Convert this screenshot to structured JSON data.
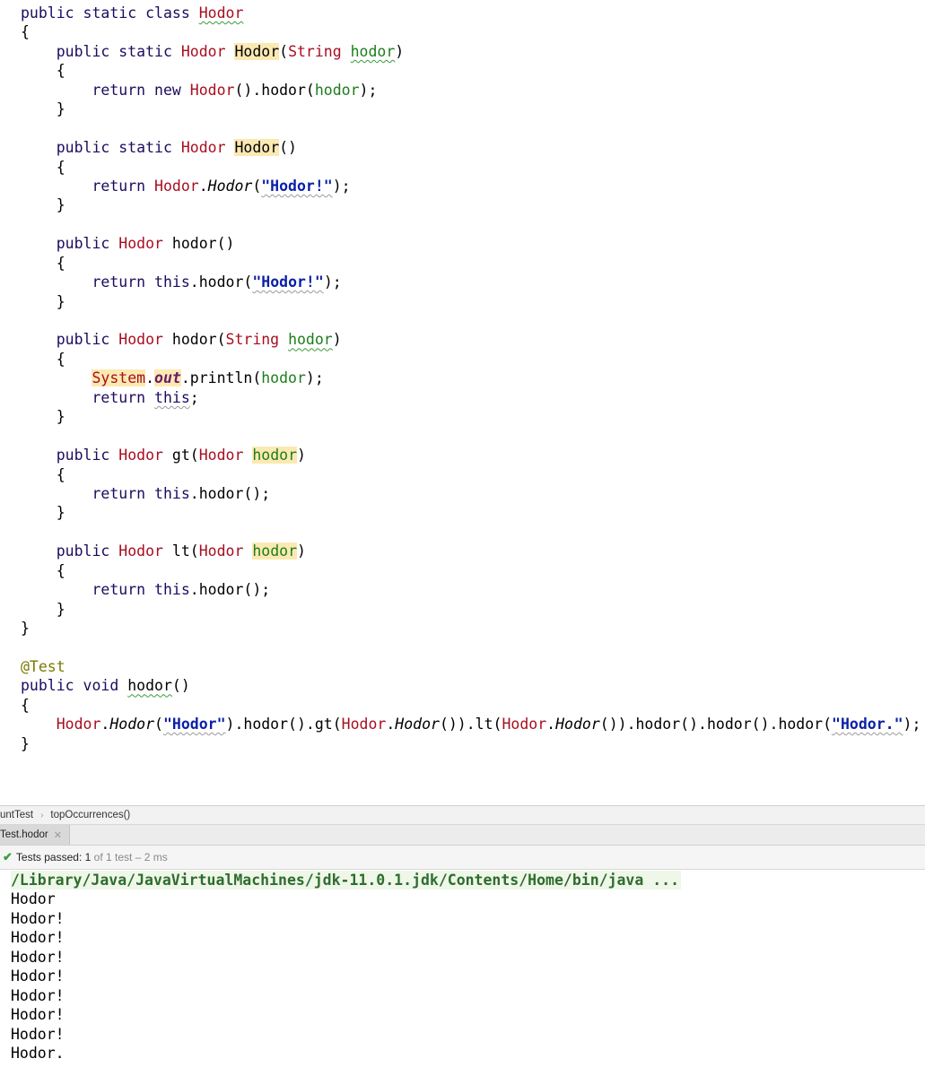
{
  "editor": {
    "lines": [
      "public static class Hodor",
      "{",
      "    public static Hodor Hodor(String hodor)",
      "    {",
      "        return new Hodor().hodor(hodor);",
      "    }",
      "",
      "    public static Hodor Hodor()",
      "    {",
      "        return Hodor.Hodor(\"Hodor!\");",
      "    }",
      "",
      "    public Hodor hodor()",
      "    {",
      "        return this.hodor(\"Hodor!\");",
      "    }",
      "",
      "    public Hodor hodor(String hodor)",
      "    {",
      "        System.out.println(hodor);",
      "        return this;",
      "    }",
      "",
      "    public Hodor gt(Hodor hodor)",
      "    {",
      "        return this.hodor();",
      "    }",
      "",
      "    public Hodor lt(Hodor hodor)",
      "    {",
      "        return this.hodor();",
      "    }",
      "}",
      "",
      "@Test",
      "public void hodor()",
      "{",
      "    Hodor.Hodor(\"Hodor\").hodor().gt(Hodor.Hodor()).lt(Hodor.Hodor()).hodor().hodor().hodor(\"Hodor.\");",
      "}"
    ]
  },
  "breadcrumb": {
    "items": [
      "untTest",
      "topOccurrences()"
    ]
  },
  "run_tab": {
    "label": "Test.hodor",
    "close_icon": "close-icon"
  },
  "status": {
    "icon": "checkmark-icon",
    "label": "Tests passed:",
    "passed": "1",
    "detail": "of 1 test – 2 ms",
    "accent": "#3e9a3e"
  },
  "console": {
    "command": "/Library/Java/JavaVirtualMachines/jdk-11.0.1.jdk/Contents/Home/bin/java ...",
    "output": [
      "Hodor",
      "Hodor!",
      "Hodor!",
      "Hodor!",
      "Hodor!",
      "Hodor!",
      "Hodor!",
      "Hodor!",
      "Hodor."
    ]
  }
}
